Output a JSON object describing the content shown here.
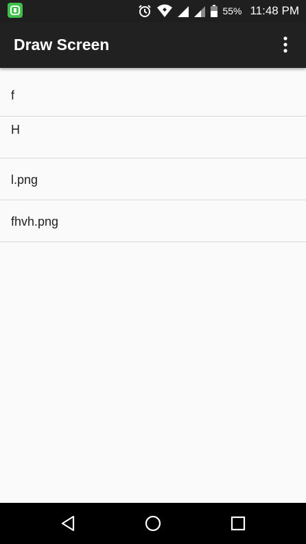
{
  "status_bar": {
    "battery_percent": "55%",
    "time": "11:48 PM",
    "icons": [
      "app-notification-icon",
      "alarm-icon",
      "wifi-icon",
      "signal-icon",
      "signal-icon-2",
      "battery-icon"
    ]
  },
  "app_bar": {
    "title": "Draw Screen",
    "menu_icon": "overflow-menu-icon"
  },
  "list": {
    "items": [
      {
        "label": "f"
      },
      {
        "label": "H"
      },
      {
        "label": "l.png"
      },
      {
        "label": "fhvh.png"
      }
    ]
  },
  "nav_bar": {
    "icons": [
      "back-icon",
      "home-icon",
      "recents-icon"
    ]
  },
  "colors": {
    "app_bar": "#212121",
    "background": "#fafafa",
    "divider": "#d9d9d9",
    "app_icon_green": "#3ec14a"
  }
}
